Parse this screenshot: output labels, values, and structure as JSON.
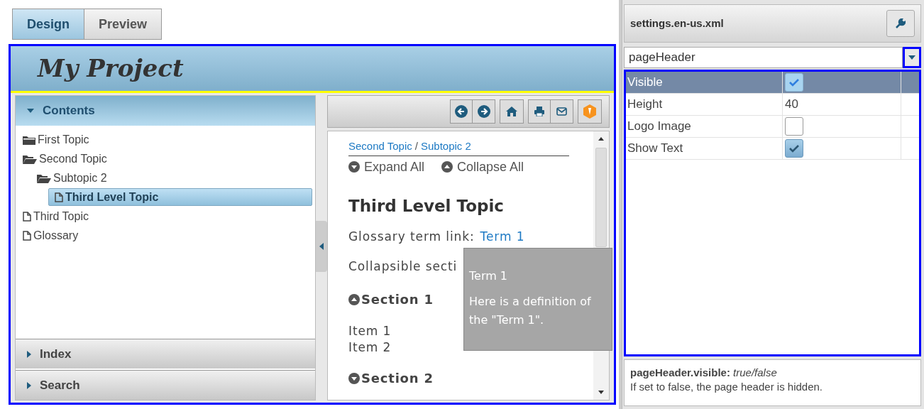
{
  "mode_tabs": [
    {
      "label": "Design",
      "selected": true
    },
    {
      "label": "Preview",
      "selected": false
    }
  ],
  "page_header": {
    "title": "My Project"
  },
  "nav_sections": [
    {
      "label": "Contents",
      "expanded": true
    },
    {
      "label": "Index",
      "expanded": false
    },
    {
      "label": "Search",
      "expanded": false
    }
  ],
  "tree": [
    {
      "label": "First Topic",
      "kind": "folder",
      "expanded": false,
      "selected": false
    },
    {
      "label": "Second Topic",
      "kind": "folder",
      "expanded": true,
      "selected": false,
      "children": [
        {
          "label": "Subtopic 2",
          "kind": "folder",
          "expanded": true,
          "selected": false,
          "children": [
            {
              "label": "Third Level Topic",
              "kind": "page",
              "selected": true
            }
          ]
        }
      ]
    },
    {
      "label": "Third Topic",
      "kind": "page",
      "selected": false
    },
    {
      "label": "Glossary",
      "kind": "page",
      "selected": false
    }
  ],
  "topic": {
    "breadcrumb": [
      "Second Topic",
      "Subtopic 2"
    ],
    "breadcrumb_separator": "/",
    "expand_all": "Expand All",
    "collapse_all": "Collapse All",
    "heading": "Third Level Topic",
    "glossary_label": "Glossary term link:",
    "glossary_link": "Term 1",
    "collapsible_text": "Collapsible secti",
    "sections": [
      {
        "title": "Section 1",
        "expanded": true,
        "items": [
          "Item 1",
          "Item 2"
        ]
      },
      {
        "title": "Section 2",
        "expanded": false
      }
    ]
  },
  "tooltip": {
    "term": "Term 1",
    "definition": "Here is a definition of the \"Term 1\"."
  },
  "settings": {
    "file": "settings.en-us.xml",
    "element": "pageHeader",
    "properties": [
      {
        "name": "Visible",
        "kind": "checkbox",
        "checked": true,
        "selected": true
      },
      {
        "name": "Height",
        "kind": "text",
        "value": "40",
        "selected": false
      },
      {
        "name": "Logo Image",
        "kind": "checkbox",
        "checked": false,
        "selected": false
      },
      {
        "name": "Show Text",
        "kind": "checkbox",
        "checked": true,
        "selected": false
      }
    ],
    "help_title": "pageHeader.visible:",
    "help_type": "true/false",
    "help_text": "If set to false, the page header is hidden."
  }
}
